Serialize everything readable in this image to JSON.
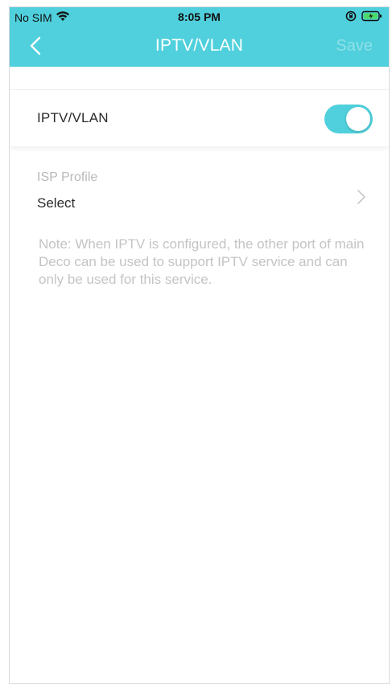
{
  "status_bar": {
    "carrier": "No SIM",
    "time": "8:05 PM",
    "icons": [
      "wifi-icon",
      "orientation-lock-icon",
      "battery-charging-icon"
    ]
  },
  "header": {
    "title": "IPTV/VLAN",
    "save_label": "Save",
    "back_icon": "chevron-left-icon"
  },
  "toggle_row": {
    "label": "IPTV/VLAN",
    "enabled": true
  },
  "isp_profile": {
    "title": "ISP Profile",
    "value": "Select",
    "icon": "chevron-right-icon"
  },
  "note": "Note: When IPTV is configured, the other port of main Deco can be used to support IPTV service and can only be used for this service.",
  "colors": {
    "accent": "#4fd0dc",
    "save_disabled": "#8fe0e8",
    "muted_text": "#c4c4c4"
  }
}
